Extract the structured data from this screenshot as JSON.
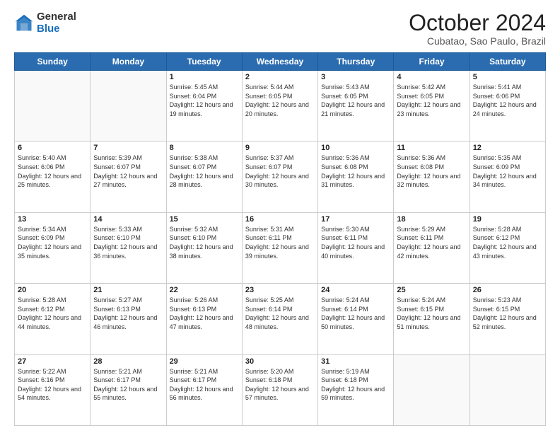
{
  "header": {
    "logo_general": "General",
    "logo_blue": "Blue",
    "title": "October 2024",
    "location": "Cubatao, Sao Paulo, Brazil"
  },
  "weekdays": [
    "Sunday",
    "Monday",
    "Tuesday",
    "Wednesday",
    "Thursday",
    "Friday",
    "Saturday"
  ],
  "weeks": [
    [
      {
        "day": "",
        "text": ""
      },
      {
        "day": "",
        "text": ""
      },
      {
        "day": "1",
        "text": "Sunrise: 5:45 AM\nSunset: 6:04 PM\nDaylight: 12 hours and 19 minutes."
      },
      {
        "day": "2",
        "text": "Sunrise: 5:44 AM\nSunset: 6:05 PM\nDaylight: 12 hours and 20 minutes."
      },
      {
        "day": "3",
        "text": "Sunrise: 5:43 AM\nSunset: 6:05 PM\nDaylight: 12 hours and 21 minutes."
      },
      {
        "day": "4",
        "text": "Sunrise: 5:42 AM\nSunset: 6:05 PM\nDaylight: 12 hours and 23 minutes."
      },
      {
        "day": "5",
        "text": "Sunrise: 5:41 AM\nSunset: 6:06 PM\nDaylight: 12 hours and 24 minutes."
      }
    ],
    [
      {
        "day": "6",
        "text": "Sunrise: 5:40 AM\nSunset: 6:06 PM\nDaylight: 12 hours and 25 minutes."
      },
      {
        "day": "7",
        "text": "Sunrise: 5:39 AM\nSunset: 6:07 PM\nDaylight: 12 hours and 27 minutes."
      },
      {
        "day": "8",
        "text": "Sunrise: 5:38 AM\nSunset: 6:07 PM\nDaylight: 12 hours and 28 minutes."
      },
      {
        "day": "9",
        "text": "Sunrise: 5:37 AM\nSunset: 6:07 PM\nDaylight: 12 hours and 30 minutes."
      },
      {
        "day": "10",
        "text": "Sunrise: 5:36 AM\nSunset: 6:08 PM\nDaylight: 12 hours and 31 minutes."
      },
      {
        "day": "11",
        "text": "Sunrise: 5:36 AM\nSunset: 6:08 PM\nDaylight: 12 hours and 32 minutes."
      },
      {
        "day": "12",
        "text": "Sunrise: 5:35 AM\nSunset: 6:09 PM\nDaylight: 12 hours and 34 minutes."
      }
    ],
    [
      {
        "day": "13",
        "text": "Sunrise: 5:34 AM\nSunset: 6:09 PM\nDaylight: 12 hours and 35 minutes."
      },
      {
        "day": "14",
        "text": "Sunrise: 5:33 AM\nSunset: 6:10 PM\nDaylight: 12 hours and 36 minutes."
      },
      {
        "day": "15",
        "text": "Sunrise: 5:32 AM\nSunset: 6:10 PM\nDaylight: 12 hours and 38 minutes."
      },
      {
        "day": "16",
        "text": "Sunrise: 5:31 AM\nSunset: 6:11 PM\nDaylight: 12 hours and 39 minutes."
      },
      {
        "day": "17",
        "text": "Sunrise: 5:30 AM\nSunset: 6:11 PM\nDaylight: 12 hours and 40 minutes."
      },
      {
        "day": "18",
        "text": "Sunrise: 5:29 AM\nSunset: 6:11 PM\nDaylight: 12 hours and 42 minutes."
      },
      {
        "day": "19",
        "text": "Sunrise: 5:28 AM\nSunset: 6:12 PM\nDaylight: 12 hours and 43 minutes."
      }
    ],
    [
      {
        "day": "20",
        "text": "Sunrise: 5:28 AM\nSunset: 6:12 PM\nDaylight: 12 hours and 44 minutes."
      },
      {
        "day": "21",
        "text": "Sunrise: 5:27 AM\nSunset: 6:13 PM\nDaylight: 12 hours and 46 minutes."
      },
      {
        "day": "22",
        "text": "Sunrise: 5:26 AM\nSunset: 6:13 PM\nDaylight: 12 hours and 47 minutes."
      },
      {
        "day": "23",
        "text": "Sunrise: 5:25 AM\nSunset: 6:14 PM\nDaylight: 12 hours and 48 minutes."
      },
      {
        "day": "24",
        "text": "Sunrise: 5:24 AM\nSunset: 6:14 PM\nDaylight: 12 hours and 50 minutes."
      },
      {
        "day": "25",
        "text": "Sunrise: 5:24 AM\nSunset: 6:15 PM\nDaylight: 12 hours and 51 minutes."
      },
      {
        "day": "26",
        "text": "Sunrise: 5:23 AM\nSunset: 6:15 PM\nDaylight: 12 hours and 52 minutes."
      }
    ],
    [
      {
        "day": "27",
        "text": "Sunrise: 5:22 AM\nSunset: 6:16 PM\nDaylight: 12 hours and 54 minutes."
      },
      {
        "day": "28",
        "text": "Sunrise: 5:21 AM\nSunset: 6:17 PM\nDaylight: 12 hours and 55 minutes."
      },
      {
        "day": "29",
        "text": "Sunrise: 5:21 AM\nSunset: 6:17 PM\nDaylight: 12 hours and 56 minutes."
      },
      {
        "day": "30",
        "text": "Sunrise: 5:20 AM\nSunset: 6:18 PM\nDaylight: 12 hours and 57 minutes."
      },
      {
        "day": "31",
        "text": "Sunrise: 5:19 AM\nSunset: 6:18 PM\nDaylight: 12 hours and 59 minutes."
      },
      {
        "day": "",
        "text": ""
      },
      {
        "day": "",
        "text": ""
      }
    ]
  ]
}
